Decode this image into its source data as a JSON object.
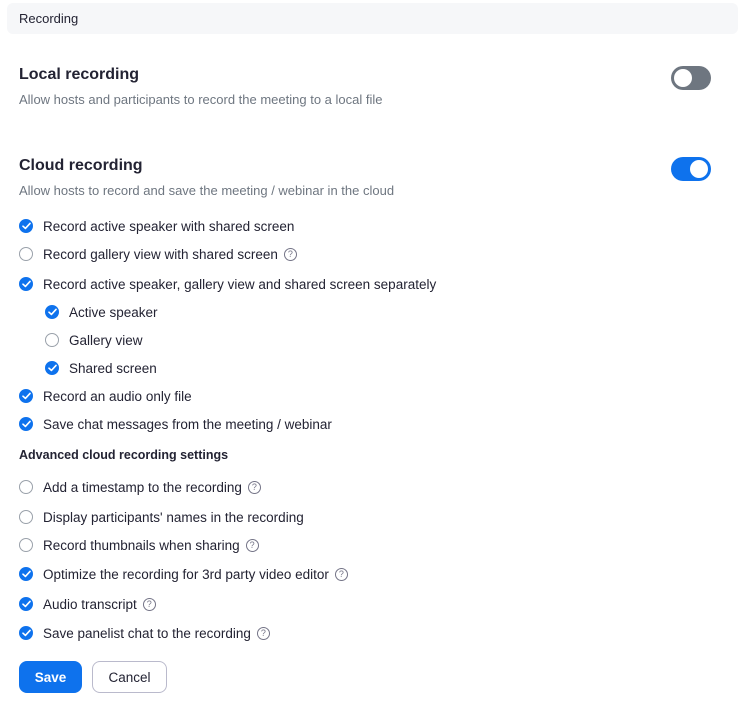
{
  "section": {
    "title": "Recording"
  },
  "local": {
    "title": "Local recording",
    "desc": "Allow hosts and participants to record the meeting to a local file",
    "enabled": false
  },
  "cloud": {
    "title": "Cloud recording",
    "desc": "Allow hosts to record and save the meeting / webinar in the cloud",
    "enabled": true,
    "options": [
      {
        "label": "Record active speaker with shared screen",
        "checked": true
      },
      {
        "label": "Record gallery view with shared screen",
        "checked": false,
        "help": true
      },
      {
        "label": "Record active speaker, gallery view and shared screen separately",
        "checked": true
      },
      {
        "label": "Active speaker",
        "checked": true
      },
      {
        "label": "Gallery view",
        "checked": false
      },
      {
        "label": "Shared screen",
        "checked": true
      },
      {
        "label": "Record an audio only file",
        "checked": true
      },
      {
        "label": "Save chat messages from the meeting / webinar",
        "checked": true
      }
    ]
  },
  "advanced": {
    "title": "Advanced cloud recording settings",
    "options": [
      {
        "label": "Add a timestamp to the recording",
        "checked": false,
        "help": true
      },
      {
        "label": "Display participants' names in the recording",
        "checked": false
      },
      {
        "label": "Record thumbnails when sharing",
        "checked": false,
        "help": true
      },
      {
        "label": "Optimize the recording for 3rd party video editor",
        "checked": true,
        "help": true
      },
      {
        "label": "Audio transcript",
        "checked": true,
        "help": true
      },
      {
        "label": "Save panelist chat to the recording",
        "checked": true,
        "help": true
      }
    ]
  },
  "help_glyph": "?",
  "buttons": {
    "save": "Save",
    "cancel": "Cancel"
  },
  "colors": {
    "accent": "#0e72ed",
    "toggle_off": "#6e7680"
  }
}
